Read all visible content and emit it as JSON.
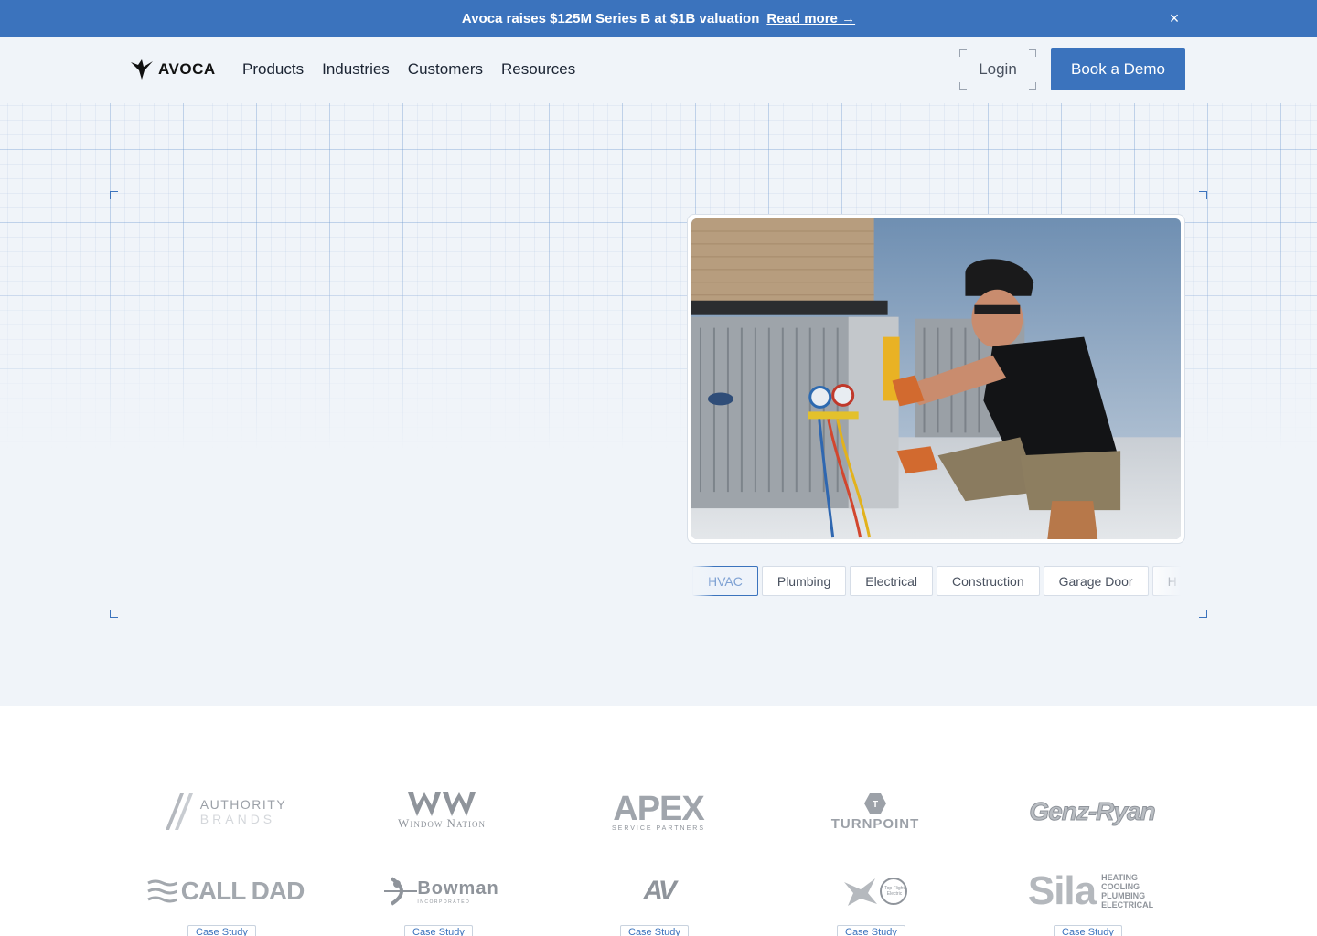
{
  "announcement": {
    "text": "Avoca raises $125M Series B at $1B valuation",
    "link": "Read more →",
    "close": "×"
  },
  "header": {
    "logo": "AVOCA",
    "nav": [
      "Products",
      "Industries",
      "Customers",
      "Resources"
    ],
    "login": "Login",
    "cta": "Book a Demo"
  },
  "hero": {
    "tabs": [
      {
        "label": "HVAC",
        "active": true
      },
      {
        "label": "Plumbing",
        "active": false
      },
      {
        "label": "Electrical",
        "active": false
      },
      {
        "label": "Construction",
        "active": false
      },
      {
        "label": "Garage Door",
        "active": false
      },
      {
        "label": "H",
        "active": false
      }
    ]
  },
  "customers": {
    "row1": [
      {
        "name": "AUTHORITY",
        "sub": "BRANDS"
      },
      {
        "name": "Window Nation",
        "sub": ""
      },
      {
        "name": "APEX",
        "sub": "SERVICE PARTNERS"
      },
      {
        "name": "TURNPOINT",
        "sub": ""
      },
      {
        "name": "Genz-Ryan",
        "sub": ""
      }
    ],
    "row2": [
      {
        "name": "CALL DAD",
        "sub": ""
      },
      {
        "name": "Bowman",
        "sub": "INCORPORATED"
      },
      {
        "name": "AV",
        "sub": ""
      },
      {
        "name": "Top Flight Electric",
        "sub": ""
      },
      {
        "name": "Sila",
        "sub": "HEATING COOLING PLUMBING ELECTRICAL"
      }
    ],
    "case_label": "Case Study"
  },
  "colors": {
    "brand": "#3b73bd",
    "hero_bg": "#f0f4f9"
  }
}
